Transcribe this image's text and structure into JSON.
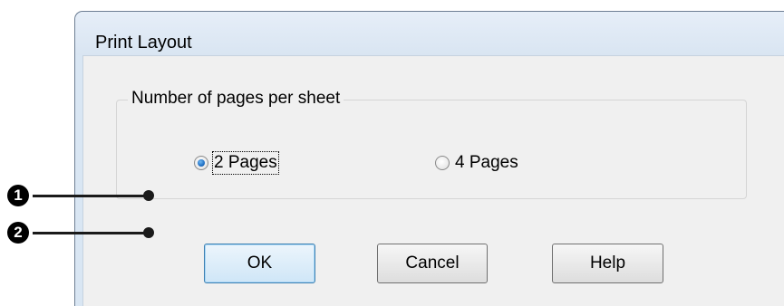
{
  "dialog": {
    "title": "Print Layout",
    "group": {
      "label": "Number of pages per sheet",
      "options": [
        {
          "label": "2 Pages",
          "checked": true
        },
        {
          "label": "4 Pages",
          "checked": false
        }
      ]
    },
    "buttons": {
      "ok": "OK",
      "cancel": "Cancel",
      "help": "Help"
    }
  },
  "callouts": [
    {
      "number": "1"
    },
    {
      "number": "2"
    }
  ],
  "colors": {
    "dialog_frame": "#d9e6f3",
    "client_background": "#f0f0f0",
    "callout": "#1a1a1a"
  }
}
